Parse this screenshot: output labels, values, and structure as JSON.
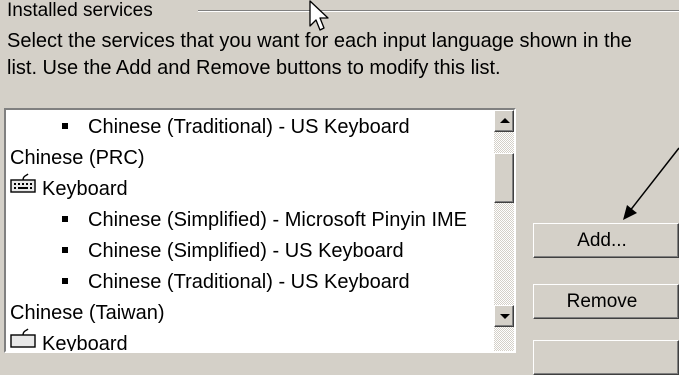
{
  "groupbox": {
    "title": "Installed services",
    "description_line1": "Select the services that you want for each input language shown in the",
    "description_line2": "list. Use the Add and Remove buttons to modify this list."
  },
  "services_list": {
    "items": [
      {
        "level": 3,
        "kind": "service",
        "label": "Chinese (Traditional) - US Keyboard"
      },
      {
        "level": 1,
        "kind": "language",
        "label": "Chinese (PRC)"
      },
      {
        "level": 2,
        "kind": "category",
        "label": "Keyboard",
        "icon": "keyboard-icon"
      },
      {
        "level": 3,
        "kind": "service",
        "label": "Chinese (Simplified) - Microsoft Pinyin IME"
      },
      {
        "level": 3,
        "kind": "service",
        "label": "Chinese (Simplified) - US Keyboard"
      },
      {
        "level": 3,
        "kind": "service",
        "label": "Chinese (Traditional) - US Keyboard"
      },
      {
        "level": 1,
        "kind": "language",
        "label": "Chinese (Taiwan)"
      },
      {
        "level": 2,
        "kind": "category",
        "label": "Keyboard",
        "icon": "keyboard-icon"
      }
    ]
  },
  "buttons": {
    "add_label": "Add...",
    "remove_label": "Remove",
    "properties_label": ""
  },
  "colors": {
    "dialog_bg": "#d4d0c8",
    "list_bg": "#ffffff"
  }
}
